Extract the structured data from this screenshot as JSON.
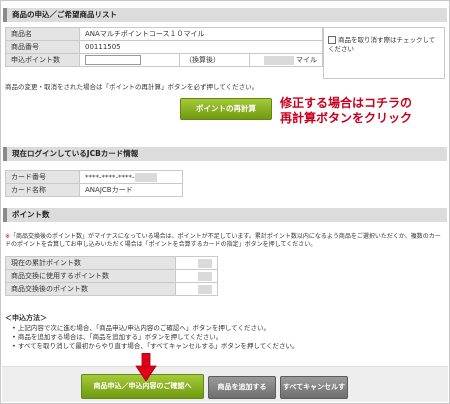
{
  "section1": {
    "title": "商品の申込／ご希望商品リスト",
    "rows": [
      {
        "label": "商品名",
        "value": "ANAマルチポイントコース１０マイル"
      },
      {
        "label": "商品番号",
        "value": "00111505"
      },
      {
        "label": "申込ポイント数",
        "value": ""
      }
    ],
    "after_conversion": "（換算後）",
    "mile_unit": "マイル",
    "remove_check_label": "商品を取り消す際はチェックしてください"
  },
  "change_note": "商品の変更・取消をされた場合は「ポイントの再計算」ボタンを必ず押してください。",
  "recalc_button": "ポイントの再計算",
  "callout": {
    "line1": "修正する場合はコチラの",
    "line2": "再計算ボタンをクリック"
  },
  "section2": {
    "title": "現在ログインしているJCBカード情報",
    "rows": [
      {
        "label": "カード番号",
        "value": "****-****-****-"
      },
      {
        "label": "カード名称",
        "value": "ANAJCBカード"
      }
    ]
  },
  "section3": {
    "title": "ポイント数",
    "notice_mark": "※",
    "notice": "「商品交換後のポイント数」がマイナスになっている場合は、ポイントが不足しています。累計ポイント数以内になるよう商品をご選択いただくか、複数のカードのポイントを合算してお申し込みいただく場合は「ポイントを合算するカードの指定」ボタンを押してください。",
    "rows": [
      {
        "label": "現在の累計ポイント数"
      },
      {
        "label": "商品交換に使用するポイント数"
      },
      {
        "label": "商品交換後のポイント数"
      }
    ]
  },
  "howto": {
    "title": "＜申込方法＞",
    "items": [
      "上記内容で次に進む場合、「商品申込/申込内容のご確認へ」ボタンを押してください。",
      "商品を追加する場合は、「商品を追加する」ボタンを押してください。",
      "すべてを取り消して最初からやり直す場合、「すべてキャンセルする」ボタンを押してください。"
    ]
  },
  "buttons": {
    "apply": "商品申込／申込内容のご確認へ",
    "add": "商品を追加する",
    "cancel_all": "すべてキャンセルする"
  },
  "colors": {
    "accent_green": "#7aa31a",
    "callout_red": "#c8001e",
    "arrow_red": "#e0001a"
  }
}
